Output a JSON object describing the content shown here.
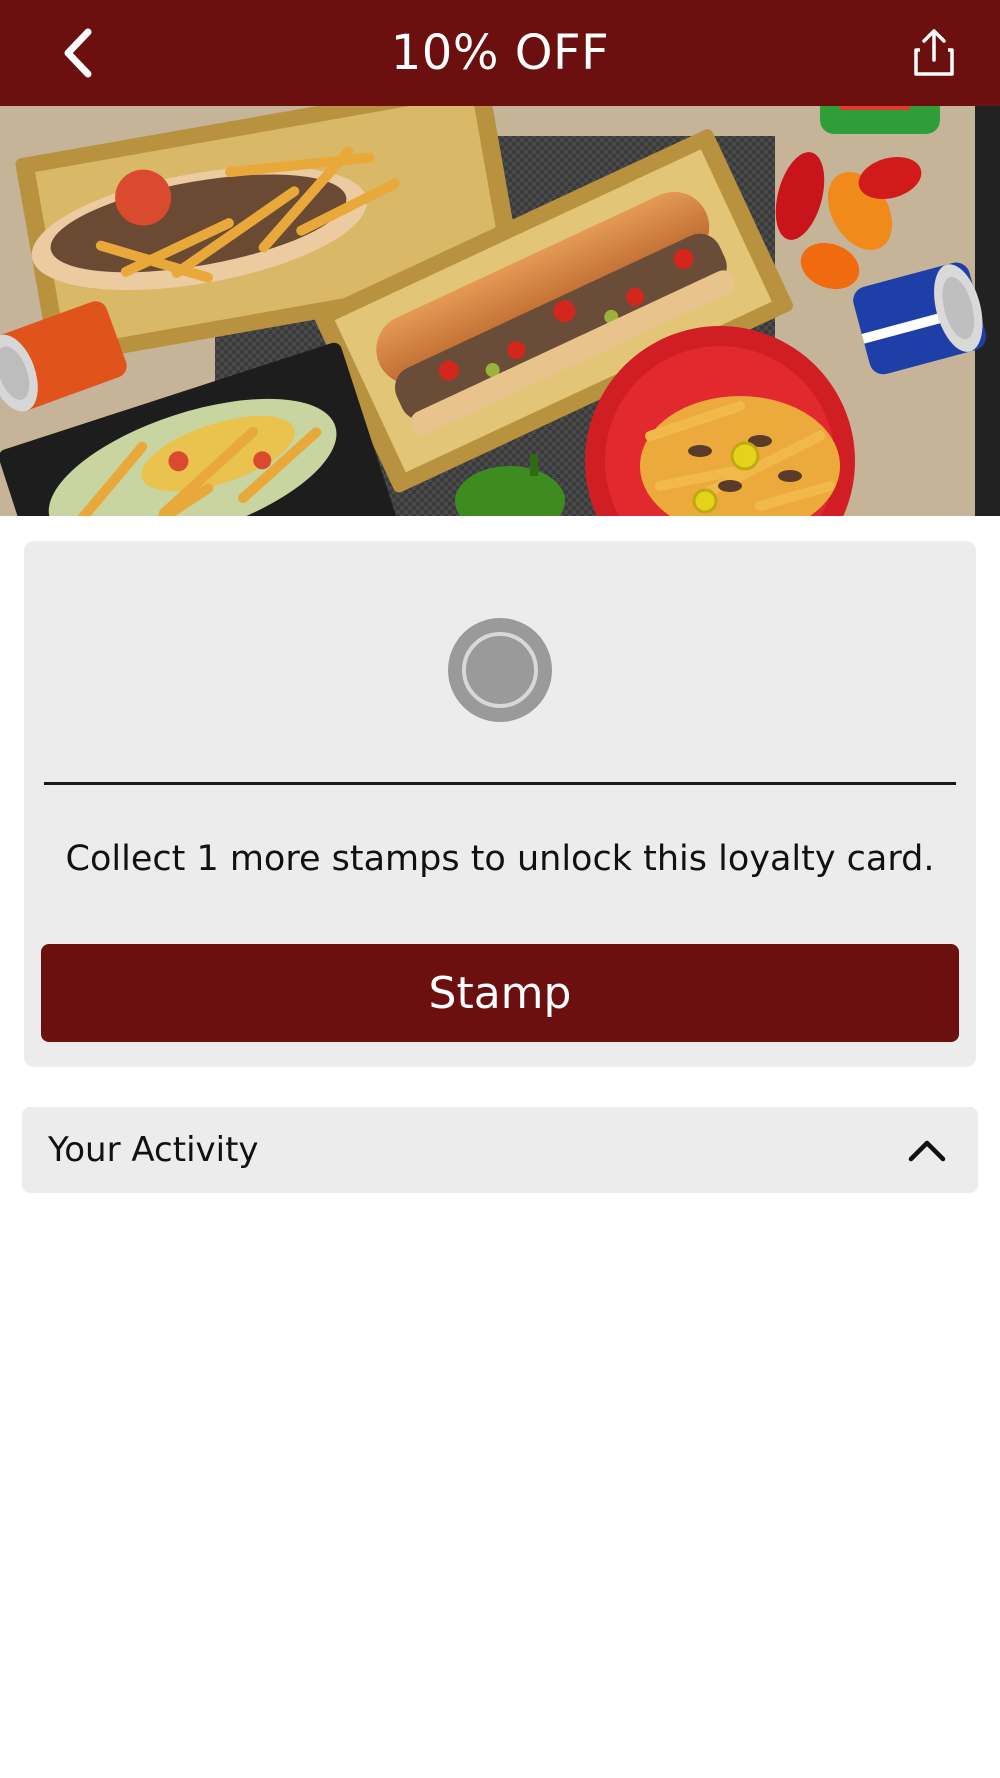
{
  "header": {
    "title": "10% OFF",
    "back_icon": "chevron-left-icon",
    "share_icon": "share-icon",
    "color": "#6b0f0f"
  },
  "hero": {
    "alt": "Cheesesteak sandwiches, fries, salad, peppers and sodas on a table"
  },
  "loyalty_card": {
    "stamps_collected": 0,
    "stamps_total": 1,
    "message": "Collect 1 more stamps to unlock this loyalty card.",
    "button_label": "Stamp",
    "accent": "#6b0f0f"
  },
  "activity": {
    "label": "Your Activity",
    "toggle_icon": "chevron-up-icon",
    "expanded": true
  }
}
